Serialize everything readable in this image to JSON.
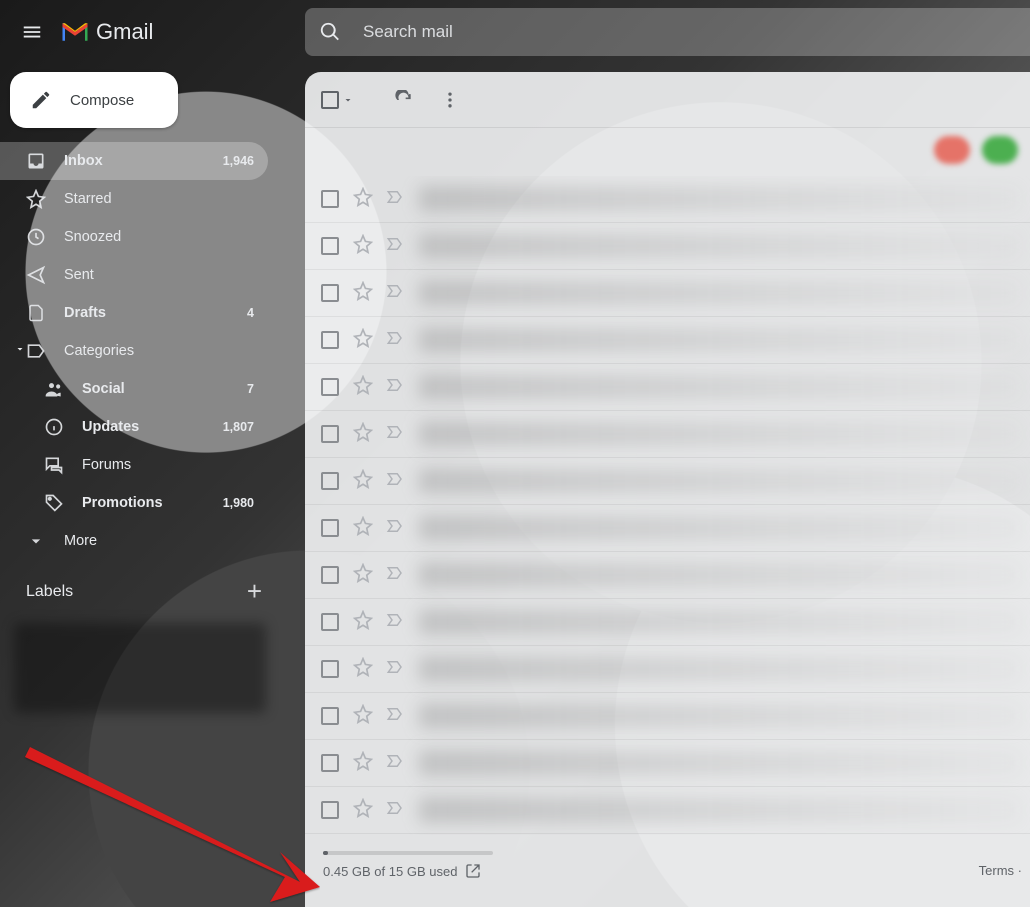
{
  "header": {
    "app_name": "Gmail",
    "search_placeholder": "Search mail"
  },
  "compose_label": "Compose",
  "nav": {
    "inbox": {
      "label": "Inbox",
      "count": "1,946"
    },
    "starred": {
      "label": "Starred"
    },
    "snoozed": {
      "label": "Snoozed"
    },
    "sent": {
      "label": "Sent"
    },
    "drafts": {
      "label": "Drafts",
      "count": "4"
    },
    "categories": {
      "label": "Categories"
    },
    "social": {
      "label": "Social",
      "count": "7"
    },
    "updates": {
      "label": "Updates",
      "count": "1,807"
    },
    "forums": {
      "label": "Forums"
    },
    "promotions": {
      "label": "Promotions",
      "count": "1,980"
    },
    "more": {
      "label": "More"
    }
  },
  "labels_header": "Labels",
  "footer": {
    "storage_text": "0.45 GB of 15 GB used",
    "terms": "Terms ·"
  }
}
